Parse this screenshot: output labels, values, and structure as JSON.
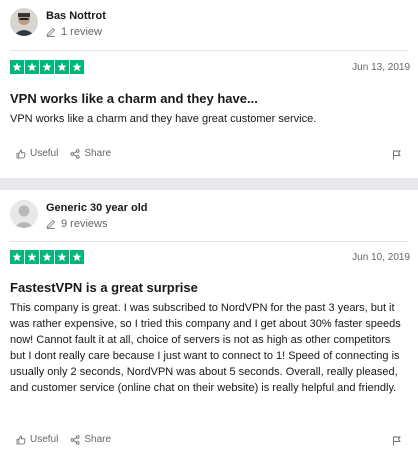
{
  "reviews": [
    {
      "reviewer": "Bas Nottrot",
      "review_count": "1 review",
      "avatar": "photo-avatar",
      "rating": 5,
      "date": "Jun 13, 2019",
      "title": "VPN works like a charm and they have...",
      "body": "VPN works like a charm and they have great customer service.",
      "useful_label": "Useful",
      "share_label": "Share"
    },
    {
      "reviewer": "Generic 30 year old",
      "review_count": "9 reviews",
      "avatar": "default-avatar",
      "rating": 5,
      "date": "Jun 10, 2019",
      "title": "FastestVPN is a great surprise",
      "body": "This company is great. I was subscribed to NordVPN for the past 3 years, but it was rather expensive, so I tried this company and I get about 30% faster speeds now! Cannot fault it at all, choice of servers is not as high as other competitors but I dont really care because I just want to connect to 1! Speed of connecting is usually only 2 seconds, NordVPN was about 5 seconds. Overall, really pleased, and customer service (online chat on their website) is really helpful and friendly.",
      "useful_label": "Useful",
      "share_label": "Share"
    }
  ],
  "colors": {
    "star_green": "#00b67a",
    "separator": "#e6e6eb"
  }
}
